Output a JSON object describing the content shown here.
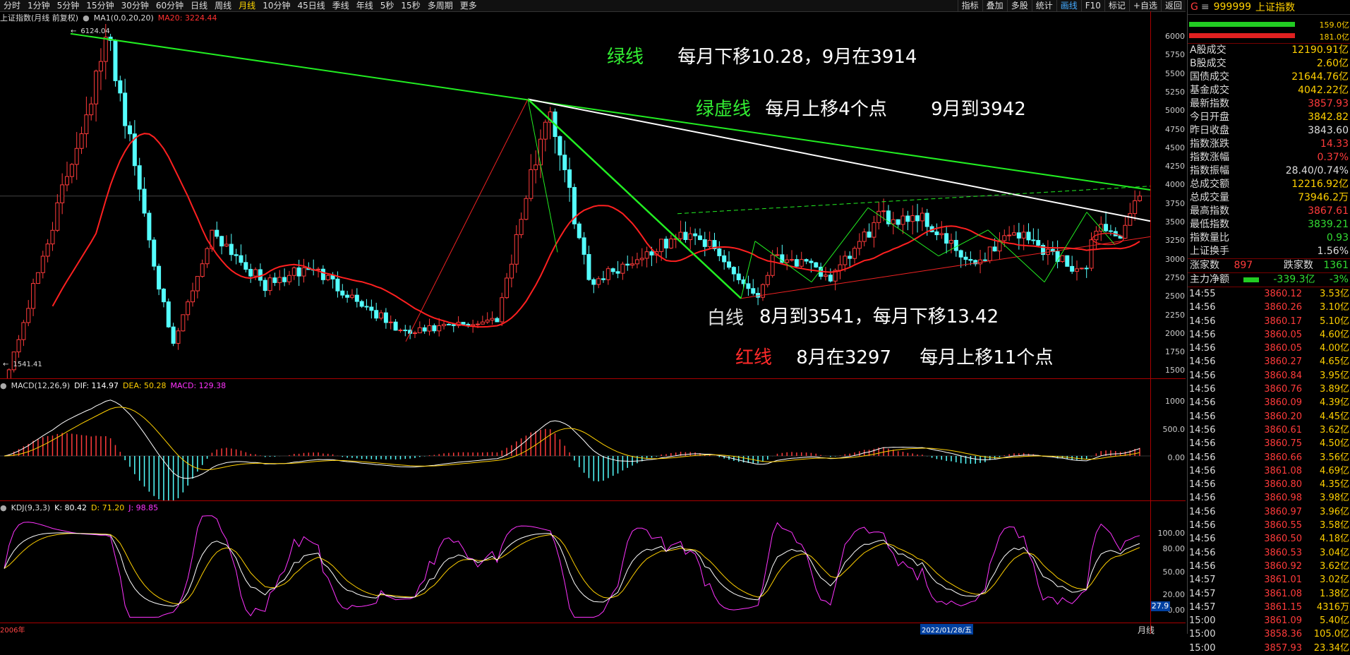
{
  "toolbar": {
    "items": [
      "分时",
      "1分钟",
      "5分钟",
      "15分钟",
      "30分钟",
      "60分钟",
      "日线",
      "周线",
      "月线",
      "10分钟",
      "45日线",
      "季线",
      "年线",
      "5秒",
      "15秒",
      "多周期",
      "更多"
    ],
    "active": 8,
    "right_items": [
      "指标",
      "叠加",
      "多股",
      "统计",
      "画线",
      "F10",
      "标记",
      "+自选",
      "返回"
    ],
    "right_active": 4
  },
  "main_header": {
    "title": "上证指数(月线 前复权)",
    "ma1": "MA1(0,0,20,20)",
    "ma20": "MA20: 3224.44"
  },
  "main_axis": {
    "ticks": [
      "6000",
      "5750",
      "5500",
      "5250",
      "5000",
      "4750",
      "4500",
      "4250",
      "4000",
      "3750",
      "3500",
      "3250",
      "3000",
      "2750",
      "2500",
      "2250",
      "2000",
      "1750",
      "1500"
    ]
  },
  "extremes": {
    "high": "6124.04",
    "low": "1541.41"
  },
  "annotations": {
    "green": {
      "label": "绿线",
      "text": "每月下移10.28，9月在3914"
    },
    "green_dashed": {
      "label": "绿虚线",
      "text": "每月上移4个点",
      "text2": "9月到3942"
    },
    "white": {
      "label": "白线",
      "text": "8月到3541，每月下移13.42"
    },
    "red": {
      "label": "红线",
      "text": "8月在3297",
      "text2": "每月上移11个点"
    }
  },
  "macd_header": {
    "name": "MACD(12,26,9)",
    "dif": "DIF: 114.97",
    "dea": "DEA: 50.28",
    "macd": "MACD: 129.38"
  },
  "macd_axis": {
    "ticks": [
      "1000",
      "500.0",
      "0.00"
    ]
  },
  "kdj_header": {
    "name": "KDJ(9,3,3)",
    "k": "K: 80.42",
    "d": "D: 71.20",
    "j": "J: 98.85"
  },
  "kdj_axis": {
    "ticks": [
      "100.00",
      "80.00",
      "50.00",
      "20.00",
      "0.00"
    ],
    "marker": "27.9"
  },
  "xaxis": {
    "start": "2006年",
    "cursor_date": "2022/01/28/五",
    "period_label": "月线"
  },
  "right_panel": {
    "code": "999999",
    "name": "上证指数",
    "bar1": "159.0亿",
    "bar2": "181.0亿",
    "stats": [
      {
        "label": "A股成交",
        "value": "12190.91亿",
        "color": "#ffd000"
      },
      {
        "label": "B股成交",
        "value": "2.60亿",
        "color": "#ffd000"
      },
      {
        "label": "国债成交",
        "value": "21644.76亿",
        "color": "#ffd000"
      },
      {
        "label": "基金成交",
        "value": "4042.22亿",
        "color": "#ffd000"
      },
      {
        "label": "最新指数",
        "value": "3857.93",
        "color": "#ff3b3b"
      },
      {
        "label": "今日开盘",
        "value": "3842.82",
        "color": "#ffd000"
      },
      {
        "label": "昨日收盘",
        "value": "3843.60",
        "color": "#dddddd"
      },
      {
        "label": "指数涨跌",
        "value": "14.33",
        "color": "#ff3b3b"
      },
      {
        "label": "指数涨幅",
        "value": "0.37%",
        "color": "#ff3b3b"
      },
      {
        "label": "指数振幅",
        "value": "28.40/0.74%",
        "color": "#dddddd"
      },
      {
        "label": "总成交额",
        "value": "12216.92亿",
        "color": "#ffd000"
      },
      {
        "label": "总成交量",
        "value": "73946.2万",
        "color": "#ffd000"
      },
      {
        "label": "最高指数",
        "value": "3867.61",
        "color": "#ff3b3b"
      },
      {
        "label": "最低指数",
        "value": "3839.21",
        "color": "#33dd33"
      },
      {
        "label": "指数量比",
        "value": "0.93",
        "color": "#33dd33"
      },
      {
        "label": "上证换手",
        "value": "1.56%",
        "color": "#dddddd"
      }
    ],
    "rise_label": "涨家数",
    "rise_value": "897",
    "fall_label": "跌家数",
    "fall_value": "1361",
    "flow_label": "主力净额",
    "flow_value": "-339.3亿",
    "flow_pct": "-3%",
    "ticks": [
      {
        "time": "14:55",
        "price": "3860.12",
        "vol": "3.53亿"
      },
      {
        "time": "14:56",
        "price": "3860.26",
        "vol": "3.10亿"
      },
      {
        "time": "14:56",
        "price": "3860.17",
        "vol": "5.10亿"
      },
      {
        "time": "14:56",
        "price": "3860.05",
        "vol": "4.60亿"
      },
      {
        "time": "14:56",
        "price": "3860.05",
        "vol": "4.00亿"
      },
      {
        "time": "14:56",
        "price": "3860.27",
        "vol": "4.65亿"
      },
      {
        "time": "14:56",
        "price": "3860.84",
        "vol": "3.95亿"
      },
      {
        "time": "14:56",
        "price": "3860.76",
        "vol": "3.89亿"
      },
      {
        "time": "14:56",
        "price": "3860.09",
        "vol": "4.39亿"
      },
      {
        "time": "14:56",
        "price": "3860.20",
        "vol": "4.45亿"
      },
      {
        "time": "14:56",
        "price": "3860.61",
        "vol": "3.62亿"
      },
      {
        "time": "14:56",
        "price": "3860.75",
        "vol": "4.50亿"
      },
      {
        "time": "14:56",
        "price": "3860.66",
        "vol": "3.56亿"
      },
      {
        "time": "14:56",
        "price": "3861.08",
        "vol": "4.69亿"
      },
      {
        "time": "14:56",
        "price": "3860.80",
        "vol": "4.35亿"
      },
      {
        "time": "14:56",
        "price": "3860.98",
        "vol": "3.98亿"
      },
      {
        "time": "14:56",
        "price": "3860.97",
        "vol": "3.96亿"
      },
      {
        "time": "14:56",
        "price": "3860.55",
        "vol": "3.58亿"
      },
      {
        "time": "14:56",
        "price": "3860.50",
        "vol": "4.18亿"
      },
      {
        "time": "14:56",
        "price": "3860.53",
        "vol": "3.04亿"
      },
      {
        "time": "14:56",
        "price": "3860.92",
        "vol": "3.62亿"
      },
      {
        "time": "14:57",
        "price": "3861.01",
        "vol": "3.02亿"
      },
      {
        "time": "14:57",
        "price": "3861.08",
        "vol": "1.38亿"
      },
      {
        "time": "14:57",
        "price": "3861.15",
        "vol": "4316万"
      },
      {
        "time": "15:00",
        "price": "3861.09",
        "vol": "5.40亿"
      },
      {
        "time": "15:00",
        "price": "3858.36",
        "vol": "105.0亿"
      },
      {
        "time": "15:00",
        "price": "3857.93",
        "vol": "23.34亿"
      }
    ]
  },
  "colors": {
    "up": "#ff3b3b",
    "down": "#54ffff",
    "ma": "#ff2020",
    "green_line": "#22ee22",
    "white_line": "#ffffff",
    "red_line": "#ee2222"
  }
}
